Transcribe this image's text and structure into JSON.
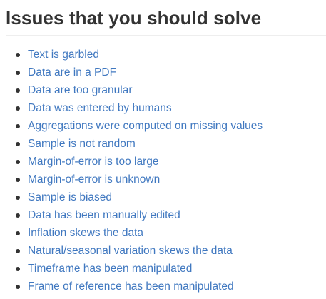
{
  "heading": "Issues that you should solve",
  "issues": [
    {
      "label": "Text is garbled"
    },
    {
      "label": "Data are in a PDF"
    },
    {
      "label": "Data are too granular"
    },
    {
      "label": "Data was entered by humans"
    },
    {
      "label": "Aggregations were computed on missing values"
    },
    {
      "label": "Sample is not random"
    },
    {
      "label": "Margin-of-error is too large"
    },
    {
      "label": "Margin-of-error is unknown"
    },
    {
      "label": "Sample is biased"
    },
    {
      "label": "Data has been manually edited"
    },
    {
      "label": "Inflation skews the data"
    },
    {
      "label": "Natural/seasonal variation skews the data"
    },
    {
      "label": "Timeframe has been manipulated"
    },
    {
      "label": "Frame of reference has been manipulated"
    }
  ],
  "colors": {
    "link": "#4078c0",
    "text": "#333333",
    "rule": "#eeeeee"
  }
}
